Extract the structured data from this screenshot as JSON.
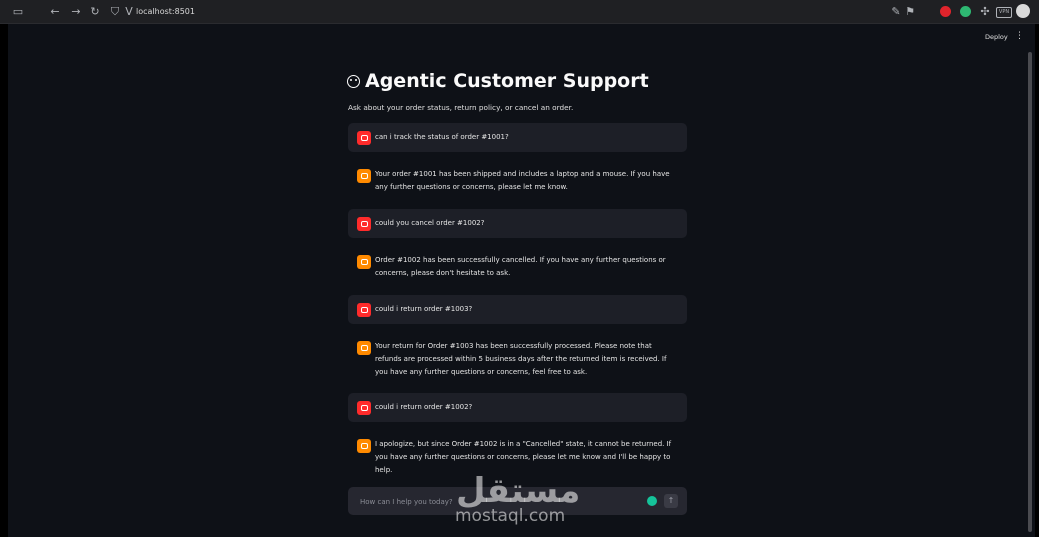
{
  "browser": {
    "url": "localhost:8501",
    "vpn_label": "VPN"
  },
  "toolbar": {
    "deploy_label": "Deploy",
    "menu_glyph": "⋮"
  },
  "app": {
    "title": "Agentic Customer Support",
    "subtitle": "Ask about your order status, return policy, or cancel an order."
  },
  "messages": [
    {
      "role": "user",
      "text": "can i track the status of order #1001?"
    },
    {
      "role": "assistant",
      "text": "Your order #1001 has been shipped and includes a laptop and a mouse. If you have any further questions or concerns, please let me know."
    },
    {
      "role": "user",
      "text": "could you cancel order #1002?"
    },
    {
      "role": "assistant",
      "text": "Order #1002 has been successfully cancelled. If you have any further questions or concerns, please don't hesitate to ask."
    },
    {
      "role": "user",
      "text": "could i return order #1003?"
    },
    {
      "role": "assistant",
      "text": "Your return for Order #1003 has been successfully processed. Please note that refunds are processed within 5 business days after the returned item is received. If you have any further questions or concerns, feel free to ask."
    },
    {
      "role": "user",
      "text": "could i return order #1002?"
    },
    {
      "role": "assistant",
      "text": "I apologize, but since Order #1002 is in a \"Cancelled\" state, it cannot be returned. If you have any further questions or concerns, please let me know and I'll be happy to help."
    }
  ],
  "chat_input": {
    "placeholder": "How can I help you today?"
  },
  "watermark": {
    "arabic": "مستقل",
    "latin": "mostaql.com"
  },
  "colors": {
    "background": "#0e1117",
    "user_avatar": "#ff2b2b",
    "assistant_avatar": "#ff8a00",
    "user_bubble": "#1d1f27"
  },
  "icons": [
    "sidebar-toggle-icon",
    "back-arrow-icon",
    "forward-arrow-icon",
    "reload-icon",
    "shield-icon",
    "site-v-icon",
    "translate-icon",
    "bookmark-icon",
    "extension-icon",
    "puzzle-icon",
    "profile-avatar",
    "user-avatar-icon",
    "bot-avatar-icon",
    "send-arrow-icon"
  ]
}
